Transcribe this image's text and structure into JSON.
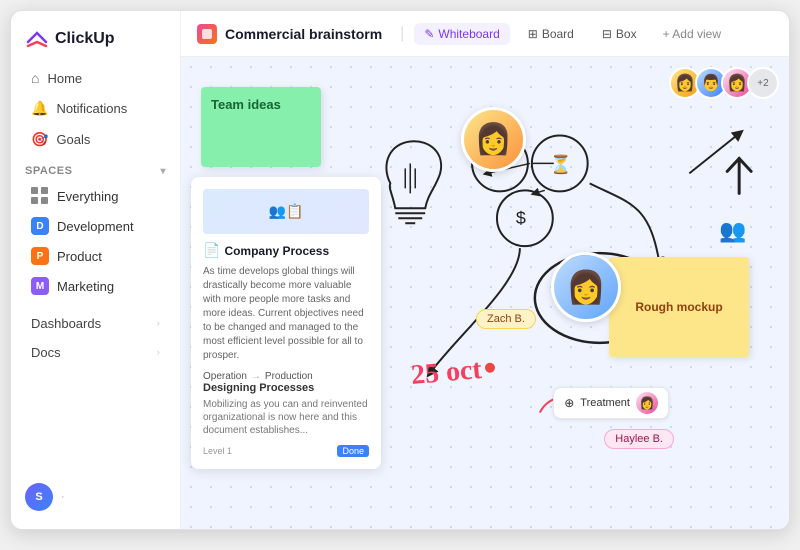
{
  "logo": {
    "text": "ClickUp",
    "icon": "🎯"
  },
  "sidebar": {
    "nav": [
      {
        "label": "Home",
        "icon": "⌂"
      },
      {
        "label": "Notifications",
        "icon": "🔔"
      },
      {
        "label": "Goals",
        "icon": "🎯"
      }
    ],
    "spaces_label": "Spaces",
    "spaces": [
      {
        "label": "Everything",
        "color": "",
        "type": "grid"
      },
      {
        "label": "Development",
        "color": "#3b82f6",
        "letter": "D"
      },
      {
        "label": "Product",
        "color": "#f97316",
        "letter": "P"
      },
      {
        "label": "Marketing",
        "color": "#8b5cf6",
        "letter": "M"
      }
    ],
    "bottom": [
      {
        "label": "Dashboards"
      },
      {
        "label": "Docs"
      }
    ],
    "user_initial": "S"
  },
  "topbar": {
    "page_title": "Commercial brainstorm",
    "tabs": [
      {
        "label": "Whiteboard",
        "icon": "✎",
        "active": true
      },
      {
        "label": "Board",
        "icon": "⊞"
      },
      {
        "label": "Box",
        "icon": "⊟"
      }
    ],
    "add_view": "+ Add view"
  },
  "canvas": {
    "sticky_green_text": "Team ideas",
    "sticky_yellow_text": "Rough mockup",
    "document": {
      "title": "Company Process",
      "body": "As time develops global things will drastically become more valuable with more people more tasks and more ideas. Current objectives need to be changed and managed to the most efficient level possible for all to prosper.",
      "sub_title": "Designing Processes",
      "sub_text": "Mobilizing as you can and reinvented organizational is now here and this document establishes...",
      "process_from": "Operation",
      "process_to": "Production",
      "label": "Level 1"
    },
    "date_text": "25 oct",
    "zach_tag": "Zach B.",
    "haylee_tag": "Haylee B.",
    "treatment_label": "Treatment",
    "avatars": [
      "👩",
      "👨",
      "👩"
    ]
  }
}
